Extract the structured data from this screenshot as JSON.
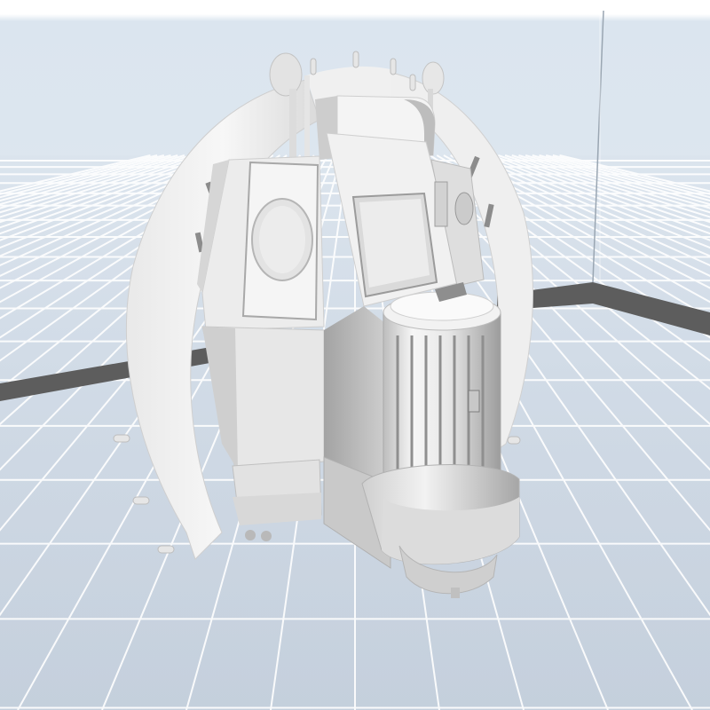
{
  "viewer": {
    "view": "perspective",
    "grid": true,
    "colors": {
      "background_top": "#ffffff",
      "background_mid": "#dde7f1",
      "floor": "#c9d4e0",
      "grid_line": "#ffffff",
      "bed_border": "#5e5e5e",
      "model_light": "#f4f4f4",
      "model_mid": "#d9d9d9",
      "model_dark": "#8e8e8e"
    }
  },
  "model": {
    "material": "untextured-grey"
  }
}
